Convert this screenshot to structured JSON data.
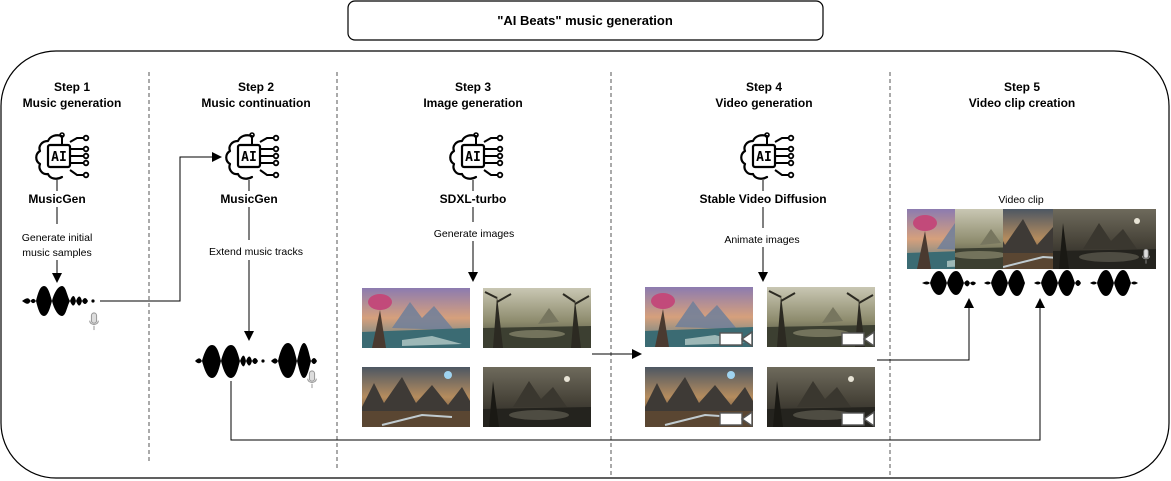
{
  "title": "\"AI Beats\" music generation",
  "steps": [
    {
      "label": "Step 1",
      "name": "Music generation",
      "model": "MusicGen",
      "caption_lines": [
        "Generate initial",
        "music samples"
      ]
    },
    {
      "label": "Step 2",
      "name": "Music continuation",
      "model": "MusicGen",
      "caption_lines": [
        "Extend music tracks"
      ]
    },
    {
      "label": "Step 3",
      "name": "Image generation",
      "model": "SDXL-turbo",
      "caption_lines": [
        "Generate images"
      ]
    },
    {
      "label": "Step 4",
      "name": "Video generation",
      "model": "Stable Video Diffusion",
      "caption_lines": [
        "Animate images"
      ]
    },
    {
      "label": "Step 5",
      "name": "Video clip creation",
      "model": "",
      "caption_lines": []
    }
  ],
  "ai_chip_text": "AI",
  "video_clip_label": "Video clip",
  "icons": [
    "ai-brain-chip-icon",
    "audio-waveform-icon",
    "microphone-icon",
    "video-camera-icon"
  ],
  "colors": {
    "stroke": "#000000",
    "background": "#ffffff",
    "separator": "#555555"
  }
}
